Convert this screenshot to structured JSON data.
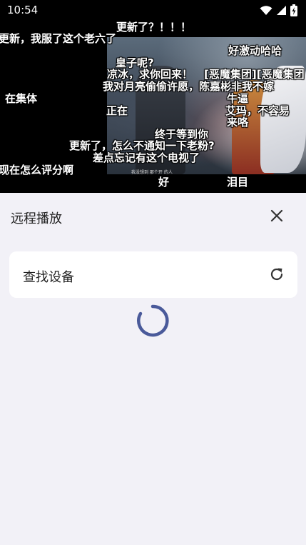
{
  "status_bar": {
    "time": "10:54",
    "icons": [
      "wifi-icon",
      "cellular-signal-icon",
      "battery-charging-icon"
    ]
  },
  "video": {
    "danmaku": [
      "更新了？！！！",
      "更新，我服了这个老六了",
      "好激动哈哈",
      "皇子呢?",
      "凉冰，求你回来！",
      "[恶魔集团][恶魔集团",
      "我对月亮偷偷许愿，陈嘉彬非我不嫁",
      "在集体",
      "牛逼",
      "正在",
      "艾玛，不容易",
      "来咯",
      "终于等到你",
      "更新了，怎么不通知一下老粉?",
      "差点忘记有这个电视了",
      "现在怎么评分啊",
      "好",
      "泪目"
    ],
    "subtitle": "我没想到 那个开 的人"
  },
  "sheet": {
    "title": "远程播放",
    "close_icon": "close-icon",
    "find_devices_label": "查找设备",
    "refresh_icon": "refresh-icon",
    "loading_icon": "loading-spinner-icon"
  },
  "colors": {
    "accent": "#4a5a9a",
    "sheet_bg": "#f2f1f7",
    "card_bg": "#ffffff"
  }
}
